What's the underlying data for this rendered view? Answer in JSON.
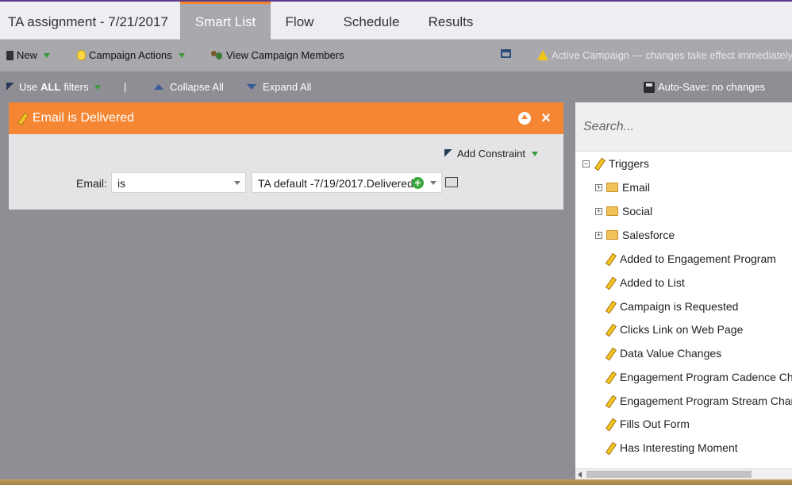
{
  "window": {
    "title": "TA assignment - 7/21/2017"
  },
  "tabs": [
    {
      "label": "Smart List",
      "active": true
    },
    {
      "label": "Flow",
      "active": false
    },
    {
      "label": "Schedule",
      "active": false
    },
    {
      "label": "Results",
      "active": false
    }
  ],
  "toolbar": {
    "new_label": "New",
    "campaign_actions_label": "Campaign Actions",
    "view_members_label": "View Campaign Members",
    "warning_text": "Active Campaign — changes take effect immediately"
  },
  "subbar": {
    "use_label": "Use",
    "all_label": "ALL",
    "filters_label": "filters",
    "divider": "|",
    "collapse_all": "Collapse All",
    "expand_all": "Expand All",
    "autosave": "Auto-Save: no changes"
  },
  "filter": {
    "title": "Email is Delivered",
    "add_constraint": "Add Constraint",
    "email_label": "Email:",
    "operator": "is",
    "email_value": "TA default -7/19/2017.Delivered"
  },
  "side_panel": {
    "search_placeholder": "Search...",
    "root": "Triggers",
    "folders": [
      "Email",
      "Social",
      "Salesforce"
    ],
    "items": [
      "Added to Engagement Program",
      "Added to List",
      "Campaign is Requested",
      "Clicks Link on Web Page",
      "Data Value Changes",
      "Engagement Program Cadence Changes",
      "Engagement Program Stream Changes",
      "Fills Out Form",
      "Has Interesting Moment"
    ]
  },
  "colors": {
    "accent": "#f58634",
    "toolbar": "#a8a8ad",
    "canvas": "#8e8e94"
  },
  "icons": [
    "doc-icon",
    "bulb-icon",
    "people-icon",
    "window-icon",
    "warning-icon",
    "filter-icon",
    "save-icon",
    "trigger-icon",
    "folder-icon"
  ]
}
